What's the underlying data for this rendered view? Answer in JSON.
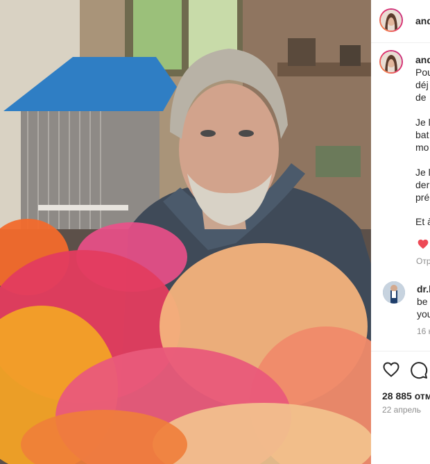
{
  "post": {
    "username": "and",
    "caption_lines": [
      "Pou",
      "déj",
      "de",
      "Je l",
      "bat",
      "mo",
      "Je l",
      "der",
      "pré",
      "Et à"
    ],
    "caption_more": "Отр"
  },
  "comment": {
    "username": "dr.l",
    "lines": [
      "be",
      "you"
    ],
    "meta": "16 н"
  },
  "stats": {
    "likes": "28 885 отм",
    "date": "22 апрель"
  },
  "icons": {
    "like": "heart-icon",
    "comment": "comment-bubble-icon",
    "liked": "red-heart-icon"
  }
}
